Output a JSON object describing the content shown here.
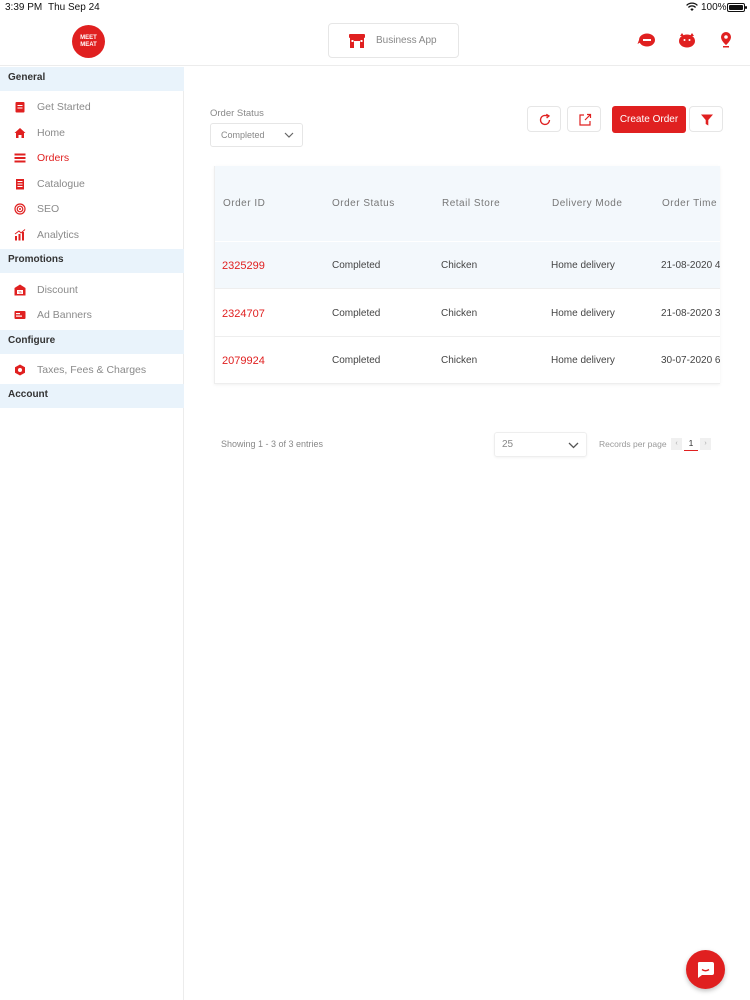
{
  "status_bar": {
    "time": "3:39 PM",
    "date": "Thu Sep 24",
    "battery": "100%",
    "battery_level": 1.0
  },
  "header": {
    "logo_text": "MEET MEAT",
    "business_app_label": "Business App",
    "icons": [
      "support-agent-icon",
      "pig-icon",
      "location-pin-icon"
    ]
  },
  "sidebar": {
    "sections": [
      {
        "title": "General",
        "items": [
          {
            "label": "Get Started",
            "icon": "clipboard-icon",
            "active": false
          },
          {
            "label": "Home",
            "icon": "home-icon",
            "active": false
          },
          {
            "label": "Orders",
            "icon": "orders-icon",
            "active": true
          },
          {
            "label": "Catalogue",
            "icon": "catalogue-icon",
            "active": false
          },
          {
            "label": "SEO",
            "icon": "target-icon",
            "active": false
          },
          {
            "label": "Analytics",
            "icon": "analytics-icon",
            "active": false
          }
        ]
      },
      {
        "title": "Promotions",
        "items": [
          {
            "label": "Discount",
            "icon": "discount-store-icon",
            "active": false
          },
          {
            "label": "Ad Banners",
            "icon": "banner-icon",
            "active": false
          }
        ]
      },
      {
        "title": "Configure",
        "items": [
          {
            "label": "Taxes, Fees & Charges",
            "icon": "taxes-icon",
            "active": false
          }
        ]
      },
      {
        "title": "Account",
        "items": []
      }
    ]
  },
  "filter": {
    "label": "Order Status",
    "selected": "Completed"
  },
  "toolbar": {
    "refresh_icon": "refresh-icon",
    "export_icon": "export-icon",
    "create_label": "Create Order",
    "filter_icon": "filter-icon"
  },
  "table": {
    "columns": [
      "Order ID",
      "Order Status",
      "Retail Store",
      "Delivery Mode",
      "Order Time"
    ],
    "rows": [
      {
        "id": "2325299",
        "status": "Completed",
        "store": "Chicken",
        "mode": "Home delivery",
        "time": "21-08-2020 4"
      },
      {
        "id": "2324707",
        "status": "Completed",
        "store": "Chicken",
        "mode": "Home delivery",
        "time": "21-08-2020 3"
      },
      {
        "id": "2079924",
        "status": "Completed",
        "store": "Chicken",
        "mode": "Home delivery",
        "time": "30-07-2020 6"
      }
    ]
  },
  "pagination": {
    "showing": "Showing 1 - 3 of 3 entries",
    "per_page": "25",
    "records_label": "Records per page",
    "prev": "‹",
    "page": "1",
    "next": "›"
  },
  "colors": {
    "accent": "#e02020",
    "section_bg": "#e9f3fb"
  }
}
